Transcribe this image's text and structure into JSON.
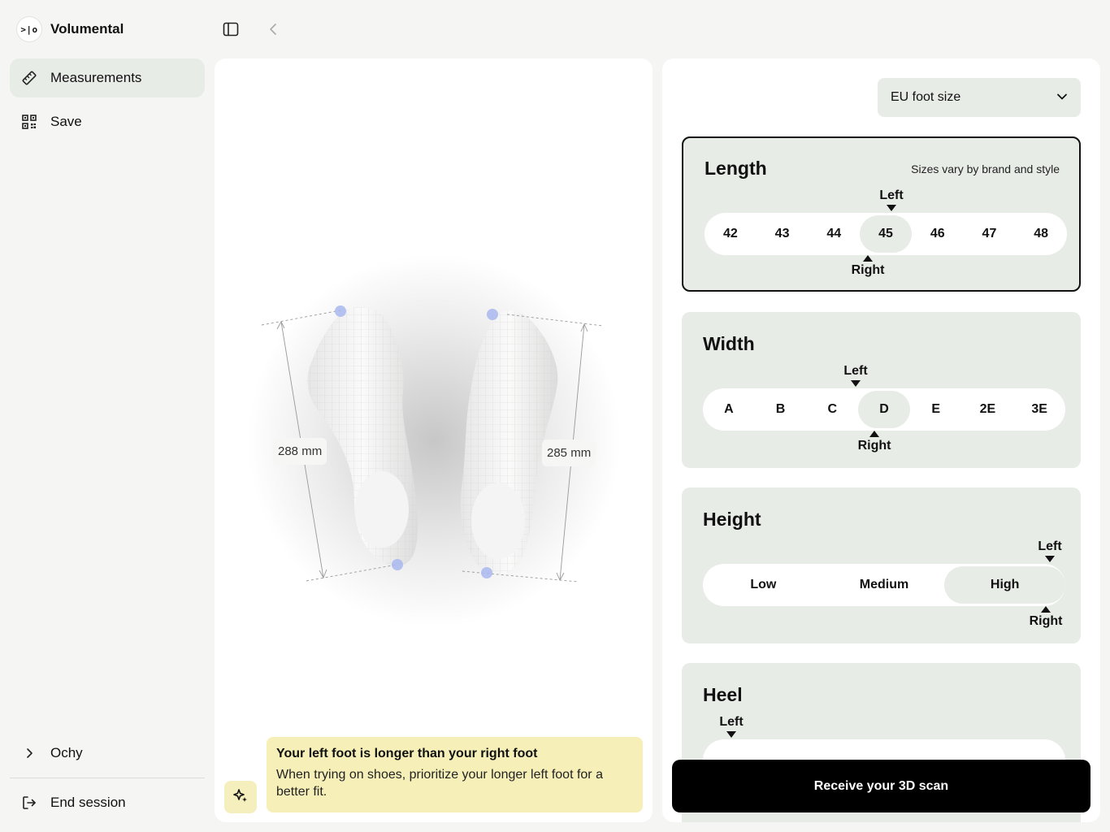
{
  "brand": {
    "logo_text": ">|o",
    "name": "Volumental"
  },
  "sidebar": {
    "items": [
      {
        "label": "Measurements",
        "icon": "ruler-icon"
      },
      {
        "label": "Save",
        "icon": "qr-code-icon"
      }
    ],
    "user": {
      "label": "Ochy",
      "icon": "chevron-right-icon"
    },
    "end_session": {
      "label": "End session",
      "icon": "logout-icon"
    }
  },
  "scan": {
    "left_length": "288 mm",
    "right_length": "285 mm"
  },
  "notice": {
    "title": "Your left foot is longer than your right foot",
    "body": "When trying on shoes, prioritize your longer left foot for a better fit."
  },
  "size_select": {
    "value": "EU foot size"
  },
  "cards": {
    "length": {
      "title": "Length",
      "note": "Sizes vary by brand and style",
      "options": [
        "42",
        "43",
        "44",
        "45",
        "46",
        "47",
        "48"
      ],
      "left_selected": "45",
      "right_selected": "45",
      "left_marker": "Left",
      "right_marker": "Right"
    },
    "width": {
      "title": "Width",
      "options": [
        "A",
        "B",
        "C",
        "D",
        "E",
        "2E",
        "3E"
      ],
      "left_selected": "D",
      "right_selected": "D",
      "left_marker": "Left",
      "right_marker": "Right"
    },
    "height": {
      "title": "Height",
      "options": [
        "Low",
        "Medium",
        "High"
      ],
      "left_selected": "High",
      "right_selected": "High",
      "left_marker": "Left",
      "right_marker": "Right"
    },
    "heel": {
      "title": "Heel",
      "left_marker": "Left"
    }
  },
  "cta": {
    "label": "Receive your 3D scan"
  },
  "colors": {
    "accent_bg": "#e8ece7",
    "notice_bg": "#f6f0b8",
    "cta_bg": "#000000",
    "marker_dot": "#a9b7ef"
  }
}
